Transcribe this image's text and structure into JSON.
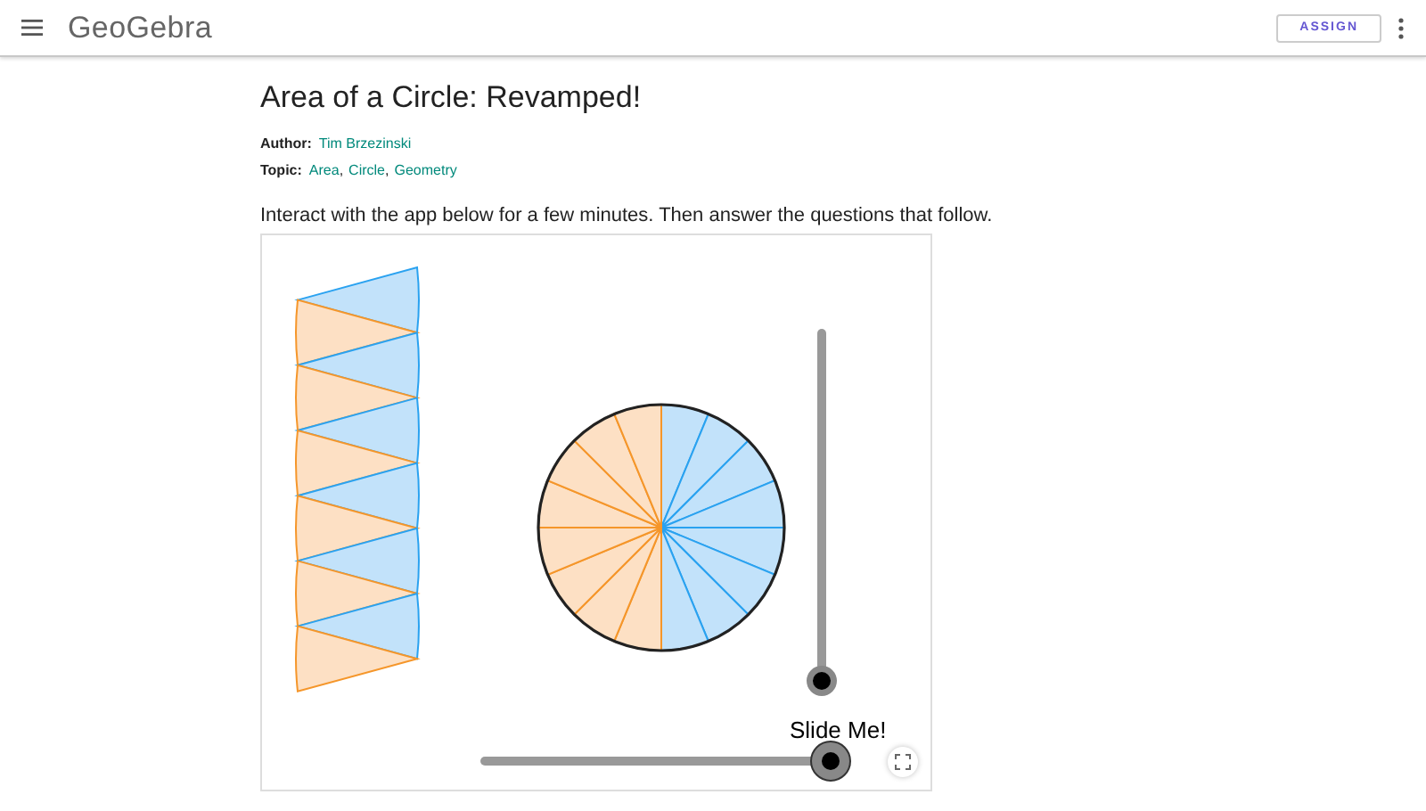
{
  "header": {
    "logo": "GeoGebra",
    "assign_button": "ASSIGN"
  },
  "title": "Area of a Circle: Revamped!",
  "author": {
    "label": "Author:",
    "name": "Tim Brzezinski"
  },
  "topic": {
    "label": "Topic:",
    "separator": ",",
    "links": [
      "Area",
      "Circle",
      "Geometry"
    ]
  },
  "intro": "Interact with the app below for a few minutes. Then answer the questions that follow.",
  "applet": {
    "slider_label": "Slide Me!",
    "sliders": [
      {
        "kind": "vertical",
        "level": 0
      },
      {
        "kind": "horizontal",
        "level": 1
      }
    ]
  }
}
